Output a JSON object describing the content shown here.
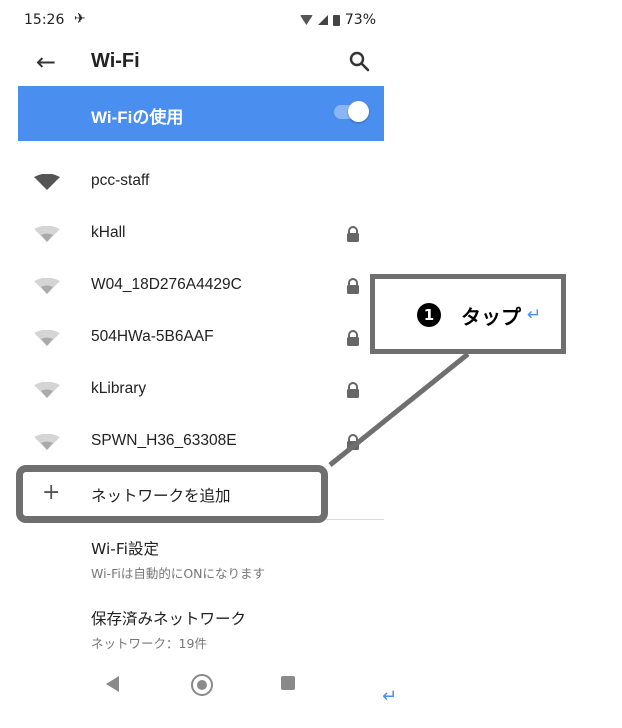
{
  "status": {
    "time": "15:26",
    "battery": "73%"
  },
  "appbar": {
    "title": "Wi-Fi"
  },
  "wifi_toggle": {
    "label": "Wi-Fiの使用",
    "on": true
  },
  "networks": [
    {
      "name": "pcc-staff",
      "secured": false,
      "connected": true
    },
    {
      "name": "kHall",
      "secured": true
    },
    {
      "name": "W04_18D276A4429C",
      "secured": true
    },
    {
      "name": "504HWa-5B6AAF",
      "secured": true
    },
    {
      "name": "kLibrary",
      "secured": true
    },
    {
      "name": "SPWN_H36_63308E",
      "secured": true
    }
  ],
  "add_network": {
    "label": "ネットワークを追加"
  },
  "settings": [
    {
      "title": "Wi-Fi設定",
      "subtitle": "Wi-Fiは自動的にONになります"
    },
    {
      "title": "保存済みネットワーク",
      "subtitle": "ネットワーク：19件"
    }
  ],
  "callout": {
    "number": "1",
    "text": "タップ",
    "return_mark": "↵"
  },
  "colors": {
    "accent": "#4a8ef0",
    "annotation": "#6f6f6f"
  }
}
